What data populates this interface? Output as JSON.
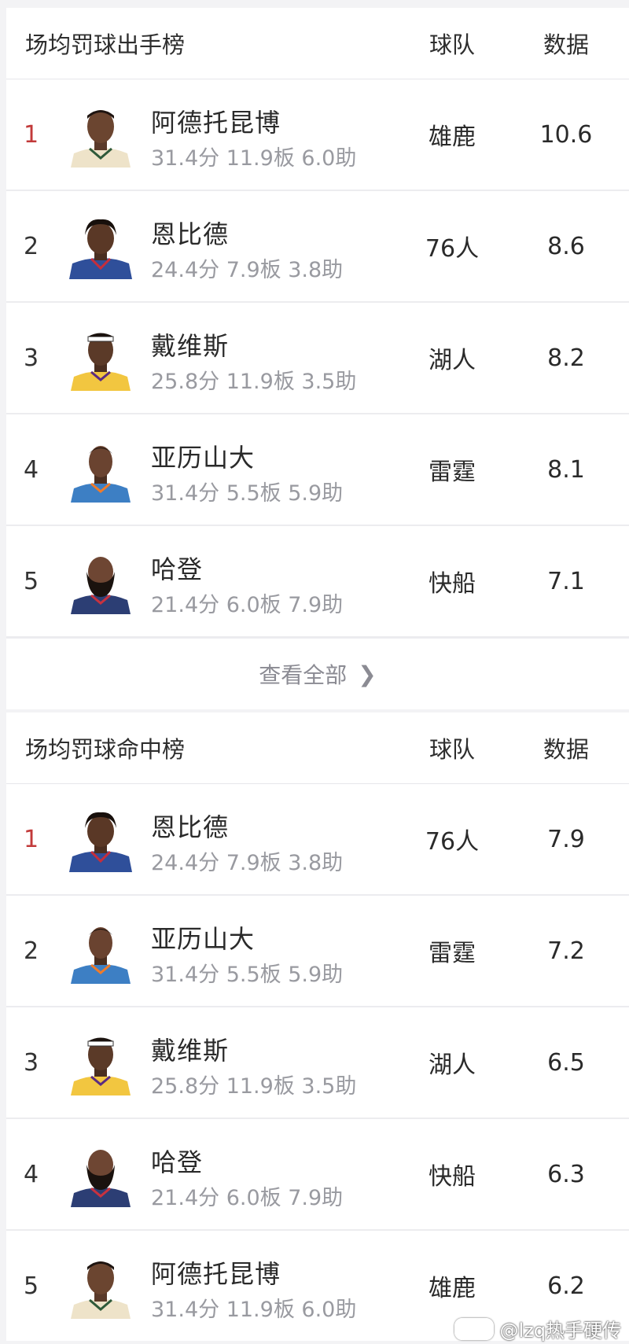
{
  "colors": {
    "rank_top": "#c23a3a",
    "muted": "#999aa0",
    "divider": "#ececef"
  },
  "attempts": {
    "title": "场均罚球出手榜",
    "col_team": "球队",
    "col_value": "数据",
    "rows": [
      {
        "rank": "1",
        "name": "阿德托昆博",
        "stats": "31.4分 11.9板 6.0助",
        "team": "雄鹿",
        "value": "10.6",
        "avatar": "player-headshot-bucks"
      },
      {
        "rank": "2",
        "name": "恩比德",
        "stats": "24.4分 7.9板 3.8助",
        "team": "76人",
        "value": "8.6",
        "avatar": "player-headshot-76ers"
      },
      {
        "rank": "3",
        "name": "戴维斯",
        "stats": "25.8分 11.9板 3.5助",
        "team": "湖人",
        "value": "8.2",
        "avatar": "player-headshot-lakers"
      },
      {
        "rank": "4",
        "name": "亚历山大",
        "stats": "31.4分 5.5板 5.9助",
        "team": "雷霆",
        "value": "8.1",
        "avatar": "player-headshot-thunder"
      },
      {
        "rank": "5",
        "name": "哈登",
        "stats": "21.4分 6.0板 7.9助",
        "team": "快船",
        "value": "7.1",
        "avatar": "player-headshot-clippers"
      }
    ],
    "view_all": "查看全部"
  },
  "made": {
    "title": "场均罚球命中榜",
    "col_team": "球队",
    "col_value": "数据",
    "rows": [
      {
        "rank": "1",
        "name": "恩比德",
        "stats": "24.4分 7.9板 3.8助",
        "team": "76人",
        "value": "7.9",
        "avatar": "player-headshot-76ers"
      },
      {
        "rank": "2",
        "name": "亚历山大",
        "stats": "31.4分 5.5板 5.9助",
        "team": "雷霆",
        "value": "7.2",
        "avatar": "player-headshot-thunder"
      },
      {
        "rank": "3",
        "name": "戴维斯",
        "stats": "25.8分 11.9板 3.5助",
        "team": "湖人",
        "value": "6.5",
        "avatar": "player-headshot-lakers"
      },
      {
        "rank": "4",
        "name": "哈登",
        "stats": "21.4分 6.0板 7.9助",
        "team": "快船",
        "value": "6.3",
        "avatar": "player-headshot-clippers"
      },
      {
        "rank": "5",
        "name": "阿德托昆博",
        "stats": "31.4分 11.9板 6.0助",
        "team": "雄鹿",
        "value": "6.2",
        "avatar": "player-headshot-bucks"
      }
    ]
  },
  "watermark": "@lzq热手硬传"
}
